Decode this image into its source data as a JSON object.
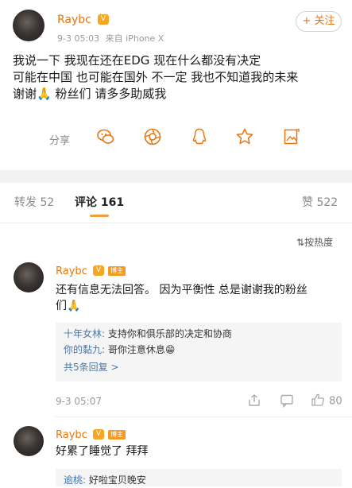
{
  "post": {
    "user": "Raybc",
    "vip": "V",
    "time": "9-3 05:03",
    "source": "来自 iPhone X",
    "follow_label": "+ 关注",
    "lines": [
      "我说一下  我现在还在EDG 现在什么都没有决定",
      " 可能在中国 也可能在国外 不一定 我也不知道我的未来",
      "谢谢🙏 粉丝们 请多多助威我"
    ],
    "share_label": "分享",
    "share_icons": [
      "wechat-icon",
      "moments-icon",
      "qq-icon",
      "qzone-star-icon",
      "image-card-icon"
    ]
  },
  "tabs": {
    "repost": "转发 52",
    "comments": "评论 161",
    "likes": "赞 522"
  },
  "sort_label": "按热度",
  "comments": [
    {
      "user": "Raybc",
      "badge": "博主",
      "lines": [
        "还有信息无法回答。 因为平衡性 总是谢谢我的粉丝",
        "们🙏"
      ],
      "replies": [
        {
          "name": "十年女林:",
          "text": " 支持你和俱乐部的决定和协商"
        },
        {
          "name": "你的黏九:",
          "text": " 哥你注意休息😁"
        }
      ],
      "more": "共5条回复 >",
      "time": "9-3 05:07",
      "likes": "80"
    },
    {
      "user": "Raybc",
      "badge": "博主",
      "lines": [
        "好累了睡觉了 拜拜"
      ],
      "replies": [
        {
          "name": "逾桃:",
          "text": " 好啦宝贝晚安"
        }
      ]
    }
  ],
  "colors": {
    "accent": "#e8750d",
    "link": "#4a76a8",
    "tab_underline": "#f39c3c"
  }
}
